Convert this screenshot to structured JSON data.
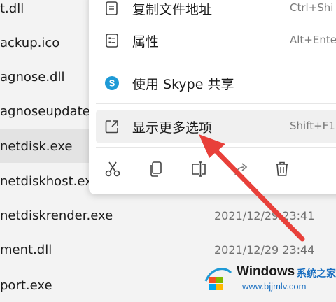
{
  "files": [
    {
      "name": "t.dll",
      "date": ""
    },
    {
      "name": "ackup.ico",
      "date": ""
    },
    {
      "name": "agnose.dll",
      "date": ""
    },
    {
      "name": "agnoseupdate",
      "date": ""
    },
    {
      "name": "netdisk.exe",
      "date": "",
      "selected": true
    },
    {
      "name": "netdiskhost.exe",
      "date": ""
    },
    {
      "name": "netdiskrender.exe",
      "date": "2021/12/29 23:41"
    },
    {
      "name": "ment.dll",
      "date": "2021/12/29 23:44"
    },
    {
      "name": "port.exe",
      "date": ""
    }
  ],
  "menu": {
    "items": [
      {
        "icon": "copy-path-icon",
        "label": "复制文件地址",
        "shortcut": "Ctrl+Shi"
      },
      {
        "icon": "properties-icon",
        "label": "属性",
        "shortcut": "Alt+Ente"
      },
      {
        "icon": "skype-icon",
        "label": "使用 Skype 共享",
        "shortcut": ""
      },
      {
        "icon": "show-more-options-icon",
        "label": "显示更多选项",
        "shortcut": "Shift+F1"
      }
    ],
    "actions": [
      {
        "icon": "cut-icon"
      },
      {
        "icon": "copy-icon"
      },
      {
        "icon": "rename-icon"
      },
      {
        "icon": "share-icon"
      },
      {
        "icon": "delete-icon"
      }
    ]
  },
  "watermark": {
    "brand": "Windows",
    "brand_cn": "系统之家",
    "url": "www.bjjmlv.com"
  },
  "colors": {
    "accent": "#e8403a",
    "skype": "#1e9ad6",
    "highlight": "#f0f0f0",
    "selected_row": "#e3e3e3"
  }
}
